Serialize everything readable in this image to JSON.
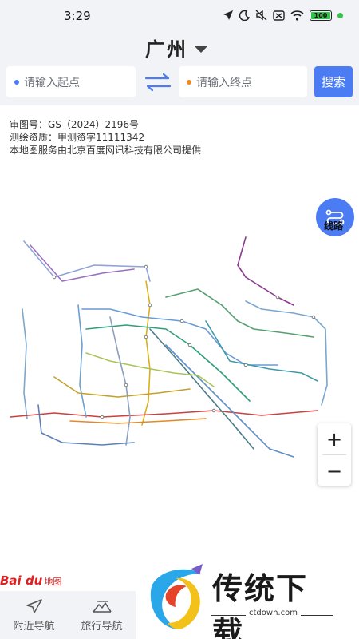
{
  "status_bar": {
    "time": "3:29",
    "battery": "100"
  },
  "header": {
    "city": "广州",
    "start_placeholder": "请输入起点",
    "end_placeholder": "请输入终点",
    "search_label": "搜索"
  },
  "map": {
    "approval_lines": [
      "审图号：GS（2024）2196号",
      "测绘资质：甲测资字11111342",
      "本地图服务由北京百度网讯科技有限公司提供"
    ],
    "route_label": "线路",
    "zoom_in": "+",
    "zoom_out": "−",
    "baidu_brand": "Bai du",
    "baidu_map_label": "地图"
  },
  "bottom_nav": {
    "nearby": "附近导航",
    "travel": "旅行导航"
  },
  "watermark": {
    "title": "传统下载",
    "url": "ctdown.com"
  },
  "colors": {
    "accent": "#4c7cf3",
    "start_dot": "#4c7cf3",
    "end_dot": "#f08a24",
    "battery": "#35c24b"
  }
}
